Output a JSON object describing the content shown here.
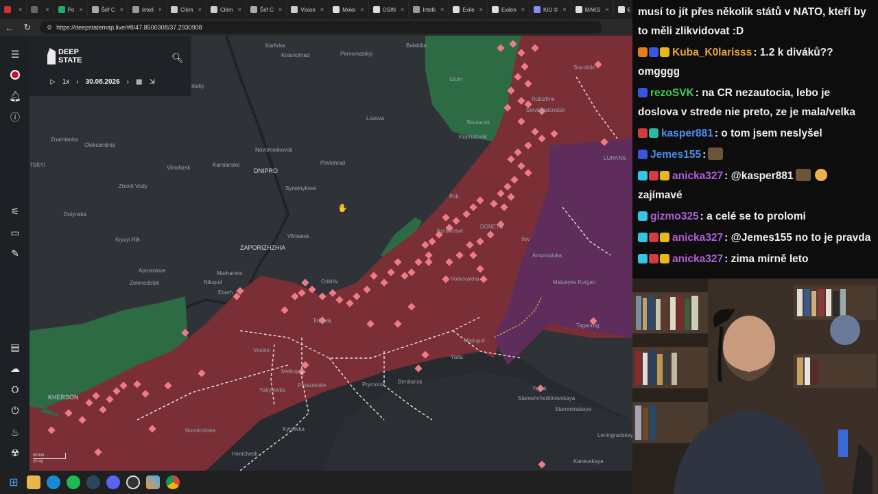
{
  "browser": {
    "tabs": [
      {
        "label": ""
      },
      {
        "label": ""
      },
      {
        "label": "Po"
      },
      {
        "label": "Šéf C"
      },
      {
        "label": "Intell"
      },
      {
        "label": "Clém"
      },
      {
        "label": "Clém"
      },
      {
        "label": "Šéf C"
      },
      {
        "label": "Vision"
      },
      {
        "label": "Molol"
      },
      {
        "label": "OSIN"
      },
      {
        "label": "Intelli"
      },
      {
        "label": "Exile"
      },
      {
        "label": "Exilen"
      },
      {
        "label": "KIU ©"
      },
      {
        "label": "MAKS"
      },
      {
        "label": "€"
      }
    ],
    "url": "https://deepstatemap.live/#8/47.8500308/37.2930908"
  },
  "map": {
    "logo": "DEEP STATE",
    "logo_line1": "DEEP",
    "logo_line2": "STATE",
    "speed": "1x",
    "date": "30.08.2026",
    "scale_km": "30 km",
    "scale_mi": "20 mi",
    "places": [
      {
        "name": "Karlivka"
      },
      {
        "name": "Krasnohrad"
      },
      {
        "name": "Pervomaiskyi"
      },
      {
        "name": "Balakliia"
      },
      {
        "name": "Izium"
      },
      {
        "name": "Starobils"
      },
      {
        "name": "Rubizhne"
      },
      {
        "name": "Sievierodonetsk"
      },
      {
        "name": "Lozova"
      },
      {
        "name": "Sloviansk"
      },
      {
        "name": "Kramatorsk"
      },
      {
        "name": "Novomoskovsk"
      },
      {
        "name": "DNIPRO"
      },
      {
        "name": "Pavlohrad"
      },
      {
        "name": "Synelnykove"
      },
      {
        "name": "Znamianka"
      },
      {
        "name": "Oleksandriia"
      },
      {
        "name": "Vilnohirsk"
      },
      {
        "name": "Kamianske"
      },
      {
        "name": "Zhovti Vody"
      },
      {
        "name": "Dolynska"
      },
      {
        "name": "Kryvyi Rih"
      },
      {
        "name": "ZAPORIZHZHIA"
      },
      {
        "name": "Vilniansk"
      },
      {
        "name": "Apostolove"
      },
      {
        "name": "Marhanets"
      },
      {
        "name": "Zelenodolsk"
      },
      {
        "name": "Nikopol"
      },
      {
        "name": "Orikhiv"
      },
      {
        "name": "Kurakhove"
      },
      {
        "name": "Volnovakha"
      },
      {
        "name": "Amvrosiivka"
      },
      {
        "name": "Matveyev Kurgan"
      },
      {
        "name": "Taganrog"
      },
      {
        "name": "Mariupol"
      },
      {
        "name": "Yalta"
      },
      {
        "name": "Berdiansk"
      },
      {
        "name": "Prymorsk"
      },
      {
        "name": "Tokmak"
      },
      {
        "name": "Melitopol"
      },
      {
        "name": "Yakymivka"
      },
      {
        "name": "Pryazovske"
      },
      {
        "name": "Vesele"
      },
      {
        "name": "Novotroitske"
      },
      {
        "name": "Kyrylivka"
      },
      {
        "name": "Henichesk"
      },
      {
        "name": "KHERSON"
      },
      {
        "name": "Staroshcherbinovskaya"
      },
      {
        "name": "Starominskaya"
      },
      {
        "name": "Leningradskaya"
      },
      {
        "name": "Kanevskaya"
      },
      {
        "name": "Yeysk"
      },
      {
        "name": "LUHANS"
      },
      {
        "name": "TSKYI"
      },
      {
        "name": "eliaky"
      },
      {
        "name": "DONETS"
      },
      {
        "name": "Ilov"
      },
      {
        "name": "Enerh"
      },
      {
        "name": "Pok"
      }
    ]
  },
  "chat": {
    "messages": [
      {
        "user": "",
        "text": "musí to jít přes několik států v NATO, kteří by to měli zlikvidovat :D",
        "color": "#ffffff"
      },
      {
        "user": "Kuba_K0larisss",
        "text": ": 1.2 k diváků?? omgggg",
        "color": "#e8a33a"
      },
      {
        "user": "rezoSVK",
        "text": ": na CR nezautocia, lebo je doslova v strede nie preto, ze je mala/velka",
        "color": "#3ecb5b"
      },
      {
        "user": "kasper881",
        "text": ": o tom jsem neslyšel",
        "color": "#4d8ff0"
      },
      {
        "user": "Jemes155",
        "text": ":",
        "color": "#4d8ff0"
      },
      {
        "user": "anicka327",
        "text": ": @kasper881",
        "text2": "zajímavé",
        "color": "#b05fd8"
      },
      {
        "user": "gizmo325",
        "text": ": a celé se to prolomi",
        "color": "#b05fd8"
      },
      {
        "user": "anicka327",
        "text": ": @Jemes155 no to je pravda",
        "color": "#b05fd8"
      },
      {
        "user": "anicka327",
        "text": ": zima mírně leto",
        "color": "#b05fd8"
      }
    ]
  },
  "colors": {
    "occupied": "#7a2f36",
    "liberated_green": "#2d6b45",
    "contested_purple": "#5e2d5c",
    "frontline_markers": "#f07b86",
    "map_bg": "#2f3338"
  }
}
